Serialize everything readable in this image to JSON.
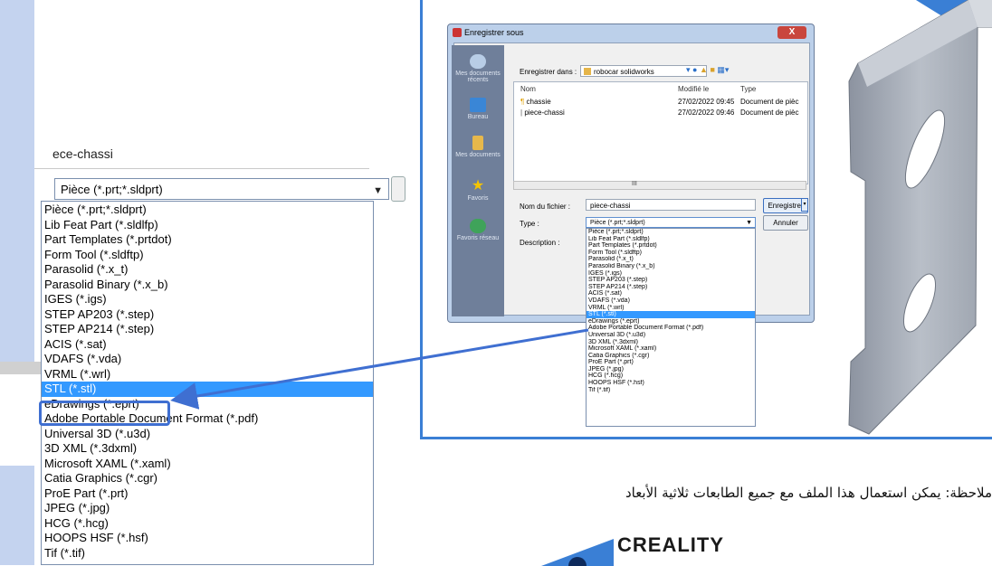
{
  "zoom": {
    "filename": "ece-chassi",
    "selected_type": "Pièce (*.prt;*.sldprt)",
    "items": [
      "Pièce (*.prt;*.sldprt)",
      "Lib Feat Part (*.sldlfp)",
      "Part Templates (*.prtdot)",
      "Form Tool (*.sldftp)",
      "Parasolid (*.x_t)",
      "Parasolid Binary (*.x_b)",
      "IGES (*.igs)",
      "STEP AP203 (*.step)",
      "STEP AP214 (*.step)",
      "ACIS (*.sat)",
      "VDAFS (*.vda)",
      "VRML (*.wrl)",
      "STL (*.stl)",
      "eDrawings (*.eprt)",
      "Adobe Portable Document Format (*.pdf)",
      "Universal 3D (*.u3d)",
      "3D XML (*.3dxml)",
      "Microsoft XAML (*.xaml)",
      "Catia Graphics (*.cgr)",
      "ProE Part (*.prt)",
      "JPEG (*.jpg)",
      "HCG (*.hcg)",
      "HOOPS HSF (*.hsf)",
      "Tif (*.tif)"
    ],
    "selected_index": 12
  },
  "dialog": {
    "title": "Enregistrer sous",
    "close": "X",
    "save_in_label": "Enregistrer dans :",
    "save_in_value": "robocar solidworks",
    "places": [
      "Mes documents récents",
      "Bureau",
      "Mes documents",
      "Favoris",
      "Favoris réseau"
    ],
    "columns": [
      "Nom",
      "Modifié le",
      "Type"
    ],
    "files": [
      {
        "name": "chassie",
        "modified": "27/02/2022 09:45",
        "type": "Document de pièc"
      },
      {
        "name": "piece-chassi",
        "modified": "27/02/2022 09:46",
        "type": "Document de pièc"
      }
    ],
    "filename_label": "Nom du fichier :",
    "filename_value": "piece-chassi",
    "type_label": "Type :",
    "type_value": "Pièce (*.prt;*.sldprt)",
    "description_label": "Description :",
    "save_button": "Enregistrer",
    "cancel_button": "Annuler",
    "scroll_mark": "III"
  },
  "note": "ملاحظة: يمكن استعمال هذا الملف مع جميع الطابعات ثلاثية الأبعاد",
  "logo": "CREALITY",
  "colors": {
    "frame_blue": "#3a7fd5",
    "selection": "#3399ff",
    "highlight_box": "#3f6fd1",
    "band": "#c4d3ef"
  }
}
